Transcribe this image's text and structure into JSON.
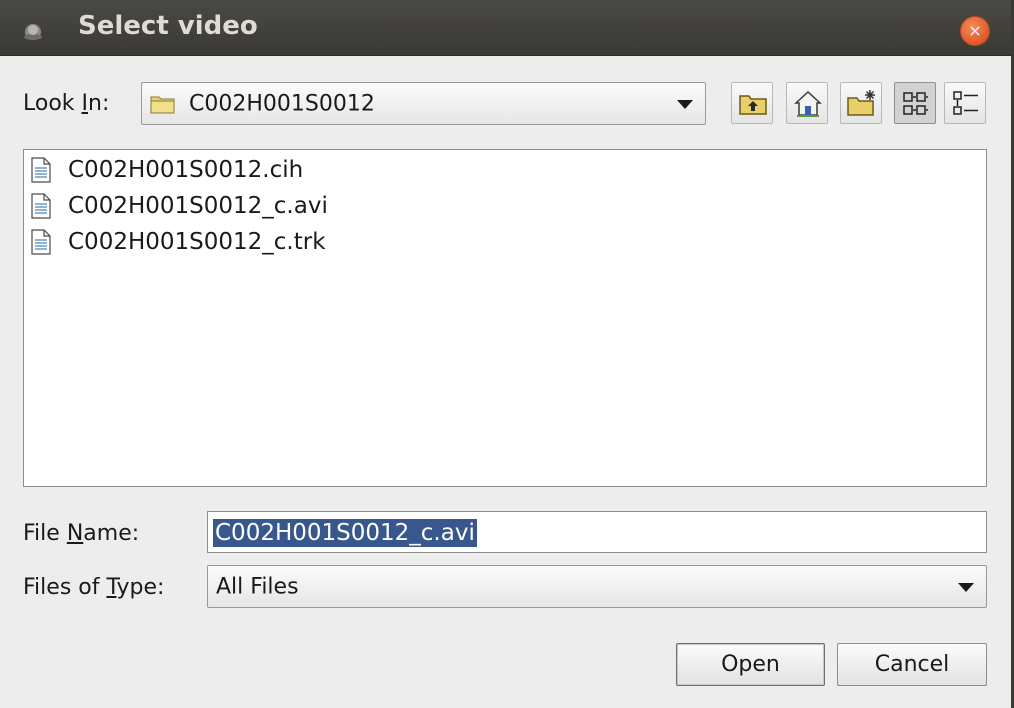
{
  "window": {
    "title": "Select video",
    "close_label": "×"
  },
  "look_in": {
    "label_pre": "Look ",
    "label_mnemonic": "I",
    "label_post": "n:",
    "value": "C002H001S0012"
  },
  "toolbar": {
    "buttons": [
      {
        "icon": "up-folder-icon"
      },
      {
        "icon": "home-icon"
      },
      {
        "icon": "new-folder-icon"
      },
      {
        "icon": "list-view-icon",
        "active": true
      },
      {
        "icon": "details-view-icon"
      }
    ]
  },
  "files": [
    {
      "name": "C002H001S0012.cih"
    },
    {
      "name": "C002H001S0012_c.avi"
    },
    {
      "name": "C002H001S0012_c.trk"
    }
  ],
  "file_name": {
    "label_pre": "File ",
    "label_mnemonic": "N",
    "label_post": "ame:",
    "value": "C002H001S0012_c.avi"
  },
  "file_type": {
    "label_pre": "Files of ",
    "label_mnemonic": "T",
    "label_post": "ype:",
    "value": "All Files"
  },
  "actions": {
    "open": "Open",
    "cancel": "Cancel"
  }
}
